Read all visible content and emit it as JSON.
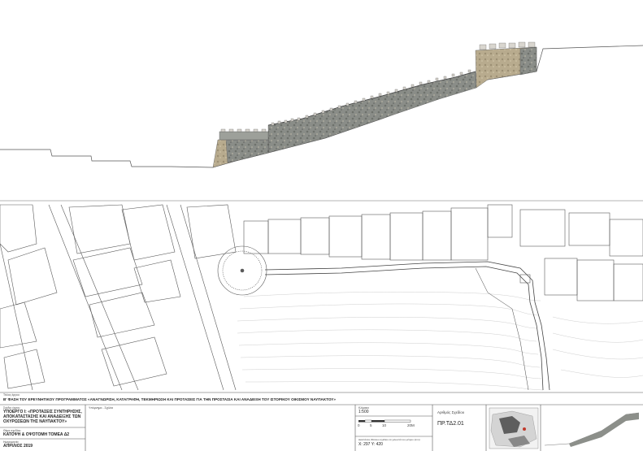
{
  "title_block": {
    "project_label": "Τίτλος έργου",
    "project_title": "Β' ΦΑΣΗ ΤΟΥ ΕΡΕΥΝΗΤΙΚΟΥ ΠΡΟΓΡΑΜΜΑΤΟΣ «ΑΝΑΓΝΩΡΙΣΗ, ΚΑΤΑΓΡΑΦΗ, ΤΕΚΜΗΡΙΩΣΗ ΚΑΙ ΠΡΟΤΑΣΕΙΣ ΓΙΑ ΤΗΝ ΠΡΟΣΤΑΣΙΑ ΚΑΙ ΑΝΑΔΕΙΞΗ ΤΟΥ ΙΣΤΟΡΙΚΟΥ ΟΙΚΙΣΜΟΥ ΝΑΥΠΑΚΤΟΥ»",
    "subproject_label": "Σχέδιο έργου",
    "subproject_lines": [
      "ΥΠΟΕΡΓΟ Ι: «ΠΡΟΤΑΣΕΙΣ ΣΥΝΤΗΡΗΣΗΣ,",
      "ΑΠΟΚΑΤΑΣΤΑΣΗΣ ΚΑΙ ΑΝΑΔΕΙΞΗΣ ΤΩΝ",
      "ΟΧΥΡΩΣΕΩΝ ΤΗΣ ΝΑΥΠΑΚΤΟΥ»"
    ],
    "drawing_label": "Θέμα σχεδίου",
    "drawing_title": "ΚΑΤΟΨΗ & ΟΨΟΤΟΜΗ ΤΟΜΕΑ Δ2",
    "date_label": "Ημερομηνία",
    "date": "ΑΠΡΙΛΙΟΣ  2019",
    "notes_label": "Υπόμνημα - Σχόλια",
    "scale_label": "Κλίμακα",
    "scale": "1:500",
    "scale_ticks": [
      "0",
      "5",
      "10",
      "20M"
    ],
    "dims_label": "Διαστάσεις Φύλλου σχεδίου σε χιλιοστά του μέτρου (mm)",
    "dims": "X: 297   Y: 420",
    "sheet_no_label": "Αριθμός Σχεδίου",
    "sheet_no": "ΠΡ.ΤΔ2.01"
  },
  "colors": {
    "line": "#5a5a5a",
    "wall_dark": "#7f8280",
    "wall_light": "#b5a88c",
    "tower": "#a89a80"
  }
}
